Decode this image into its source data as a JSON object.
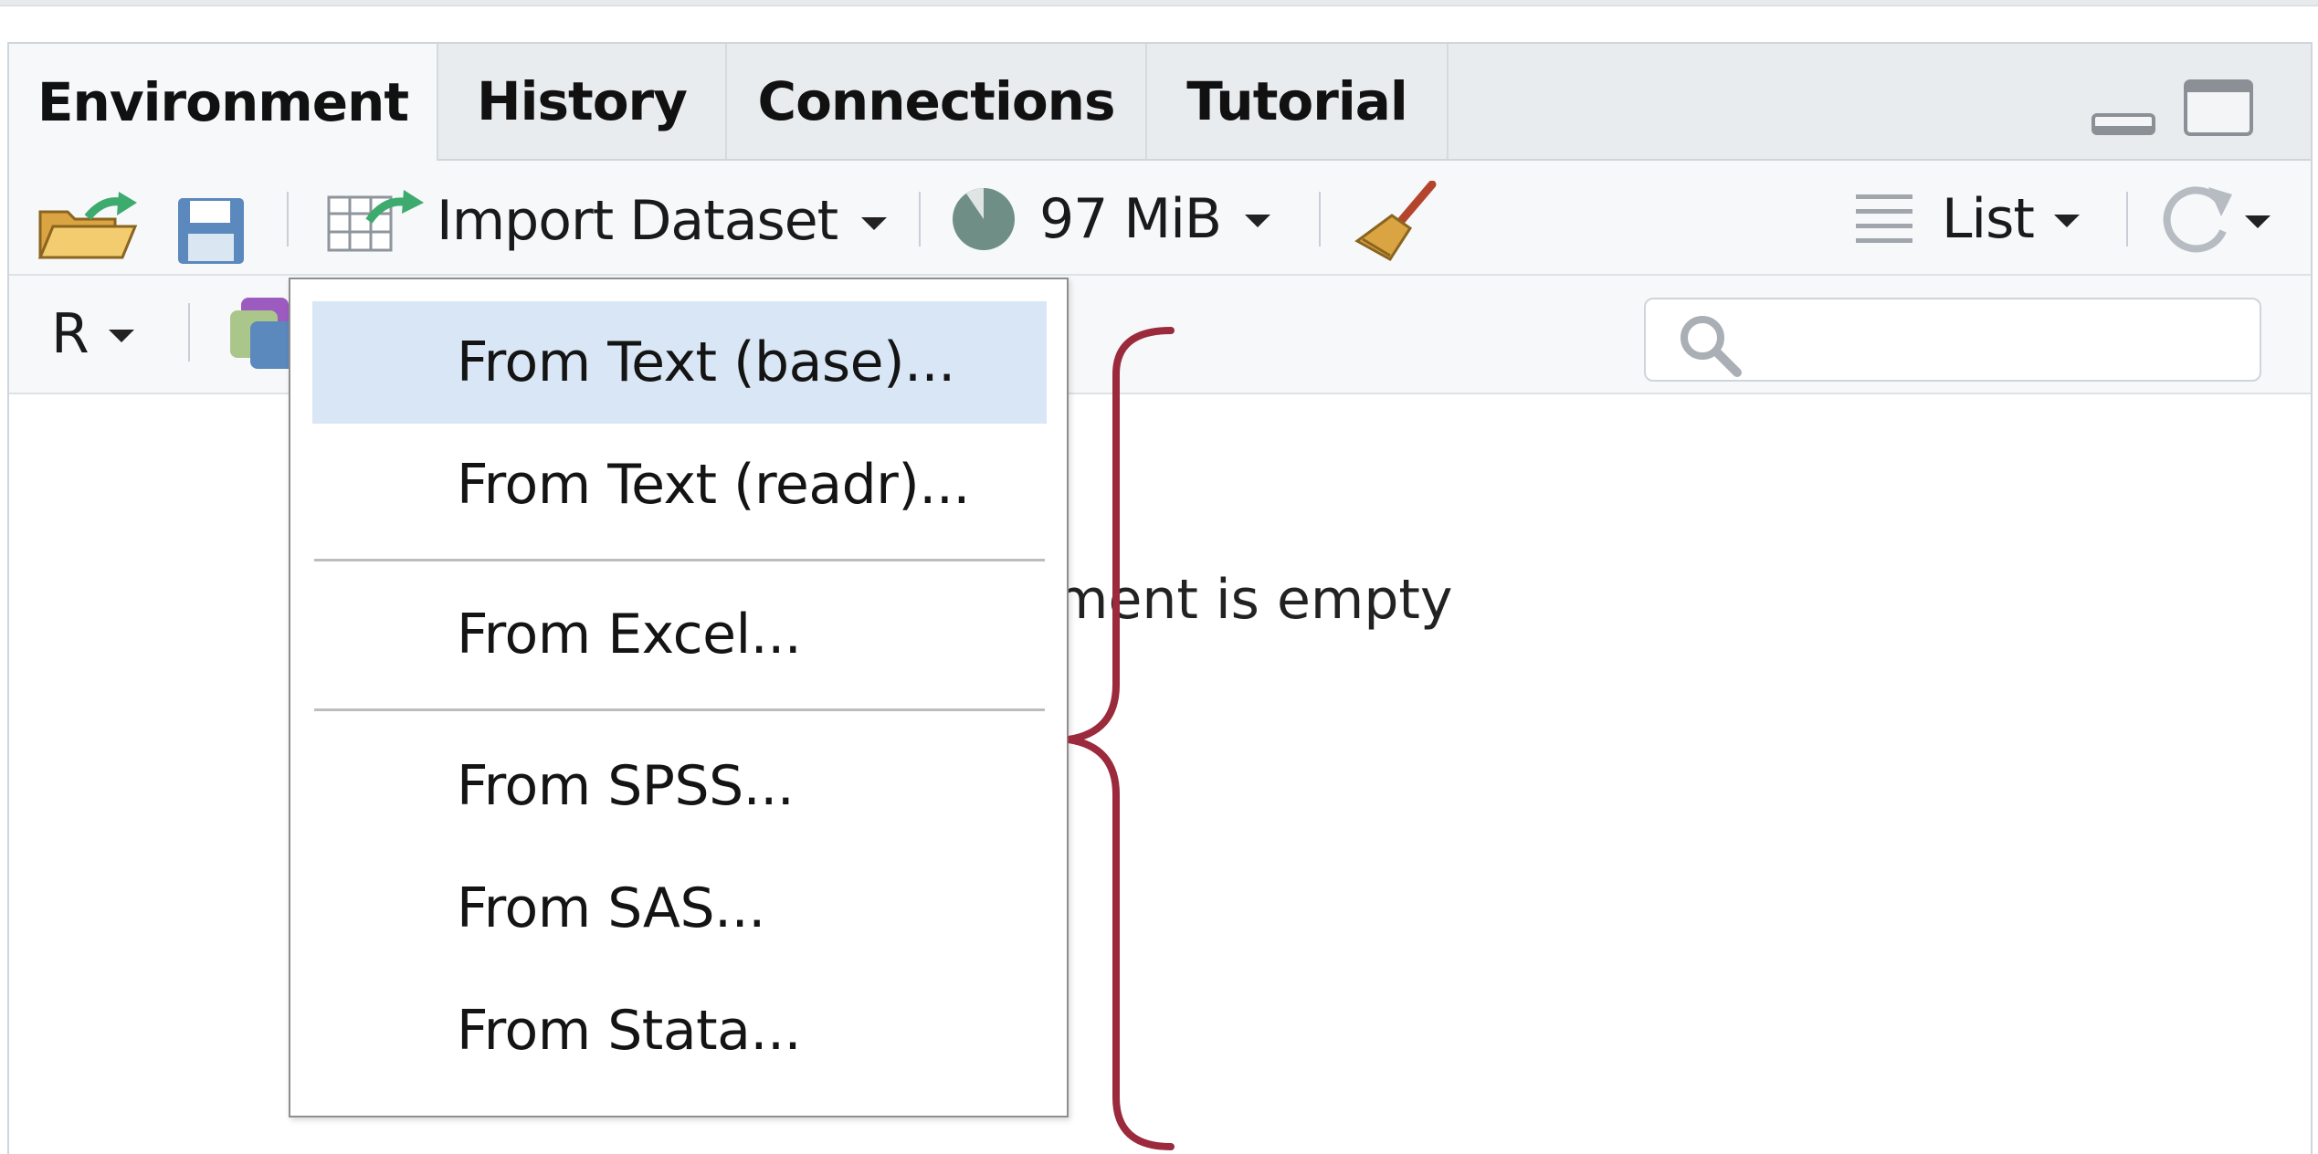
{
  "tabs": [
    "Environment",
    "History",
    "Connections",
    "Tutorial"
  ],
  "active_tab": "Environment",
  "toolbar": {
    "import_label": "Import Dataset",
    "memory_label": "97 MiB",
    "view_label": "List"
  },
  "toolbar2": {
    "language_label": "R"
  },
  "empty_message": "ment is empty",
  "import_menu": {
    "items": [
      {
        "label": "From Text (base)...",
        "highlighted": true
      },
      {
        "label": "From Text (readr)...",
        "highlighted": false
      },
      {
        "label": "From Excel...",
        "highlighted": false
      },
      {
        "label": "From SPSS...",
        "highlighted": false
      },
      {
        "label": "From SAS...",
        "highlighted": false
      },
      {
        "label": "From Stata...",
        "highlighted": false
      }
    ]
  },
  "colors": {
    "highlight": "#d8e6f5",
    "bracket": "#9a2a3c",
    "green_arrow": "#3daa6e",
    "save_icon": "#5b88bd"
  },
  "icons": [
    "open-folder-icon",
    "save-icon",
    "import-table-icon",
    "memory-pie-icon",
    "broom-icon",
    "list-lines-icon",
    "refresh-icon",
    "search-icon",
    "minimize-icon",
    "maximize-icon",
    "stacked-squares-icon"
  ]
}
